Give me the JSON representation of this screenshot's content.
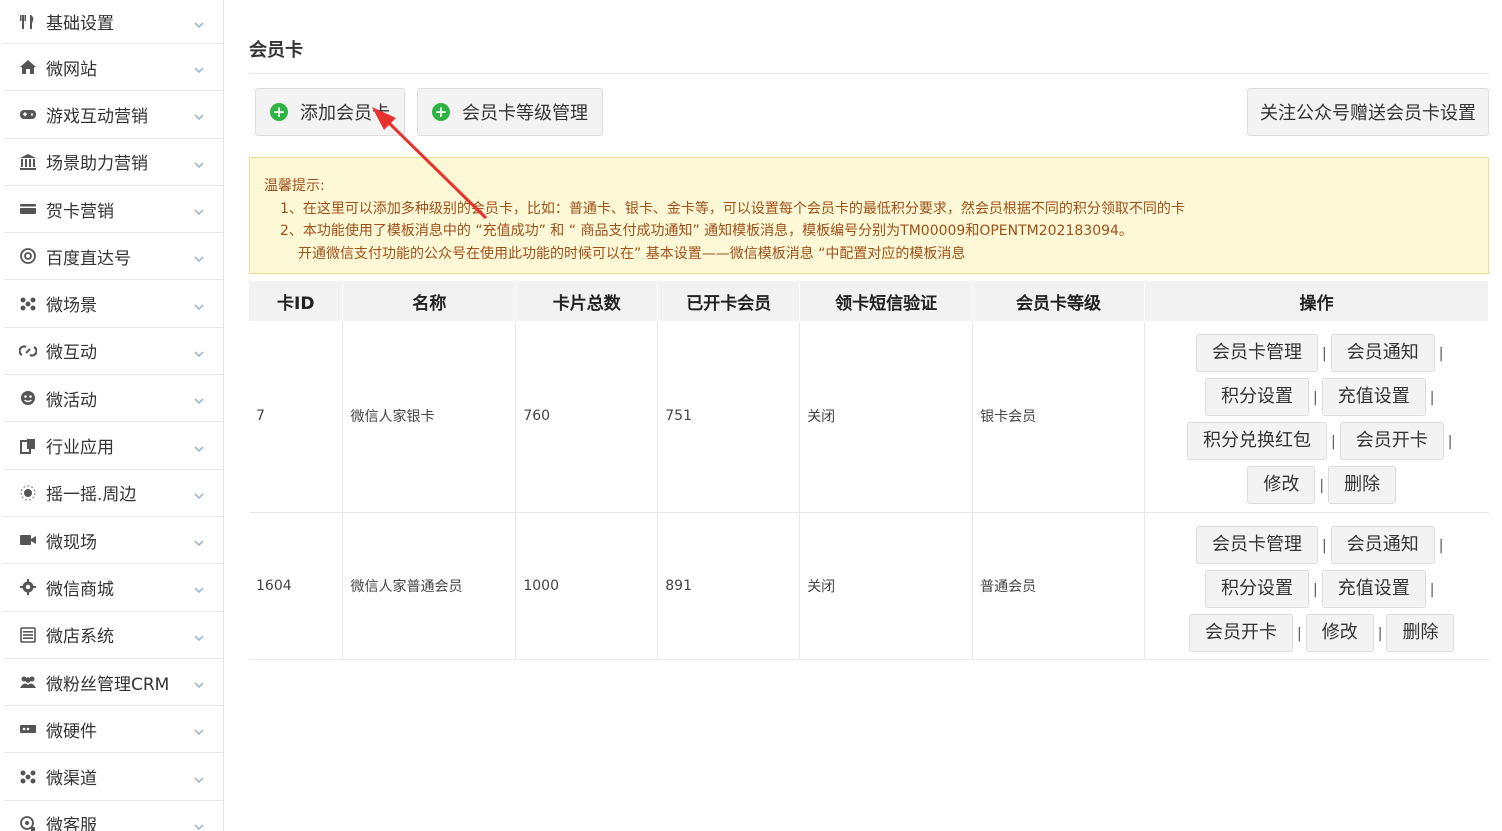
{
  "sidebar": {
    "items": [
      {
        "label": "基础设置",
        "icon": "utensils-icon"
      },
      {
        "label": "微网站",
        "icon": "home-icon"
      },
      {
        "label": "游戏互动营销",
        "icon": "gamepad-icon"
      },
      {
        "label": "场景助力营销",
        "icon": "bank-icon"
      },
      {
        "label": "贺卡营销",
        "icon": "card-icon"
      },
      {
        "label": "百度直达号",
        "icon": "at-icon"
      },
      {
        "label": "微场景",
        "icon": "dots-icon"
      },
      {
        "label": "微互动",
        "icon": "chain-icon"
      },
      {
        "label": "微活动",
        "icon": "face-icon"
      },
      {
        "label": "行业应用",
        "icon": "copy-icon"
      },
      {
        "label": "摇一摇.周边",
        "icon": "shake-icon"
      },
      {
        "label": "微现场",
        "icon": "video-icon"
      },
      {
        "label": "微信商城",
        "icon": "gear-icon"
      },
      {
        "label": "微店系统",
        "icon": "list-icon"
      },
      {
        "label": "微粉丝管理CRM",
        "icon": "users-icon"
      },
      {
        "label": "微硬件",
        "icon": "hardware-icon"
      },
      {
        "label": "微渠道",
        "icon": "network-icon"
      },
      {
        "label": "微客服",
        "icon": "support-icon"
      }
    ]
  },
  "page": {
    "title": "会员卡",
    "add_card_label": "添加会员卡",
    "level_manage_label": "会员卡等级管理",
    "follow_gift_label": "关注公众号赠送会员卡设置"
  },
  "notice": {
    "heading": "温馨提示:",
    "line1": "1、在这里可以添加多种级别的会员卡，比如：普通卡、银卡、金卡等，可以设置每个会员卡的最低积分要求，然会员根据不同的积分领取不同的卡",
    "line2": "2、本功能使用了模板消息中的 “充值成功” 和 “ 商品支付成功通知” 通知模板消息，模板编号分别为TM00009和OPENTM202183094。",
    "line3": "开通微信支付功能的公众号在使用此功能的时候可以在” 基本设置——微信模板消息 “中配置对应的模板消息"
  },
  "table": {
    "headers": [
      "卡ID",
      "名称",
      "卡片总数",
      "已开卡会员",
      "领卡短信验证",
      "会员卡等级",
      "操作"
    ],
    "rows": [
      {
        "id": "7",
        "name": "微信人家银卡",
        "total": "760",
        "opened": "751",
        "sms": "关闭",
        "level": "银卡会员",
        "ops": {
          "manage": "会员卡管理",
          "notify": "会员通知",
          "points": "积分设置",
          "recharge": "充值设置",
          "redpack": "积分兑换红包",
          "open": "会员开卡",
          "edit": "修改",
          "delete": "删除"
        }
      },
      {
        "id": "1604",
        "name": "微信人家普通会员",
        "total": "1000",
        "opened": "891",
        "sms": "关闭",
        "level": "普通会员",
        "ops": {
          "manage": "会员卡管理",
          "notify": "会员通知",
          "points": "积分设置",
          "recharge": "充值设置",
          "open": "会员开卡",
          "edit": "修改",
          "delete": "删除"
        }
      }
    ],
    "separator": "|"
  },
  "colors": {
    "accent_green": "#2fb344",
    "notice_bg": "#fdf8d6",
    "notice_text": "#a0501a",
    "arrow": "#e8322d"
  }
}
